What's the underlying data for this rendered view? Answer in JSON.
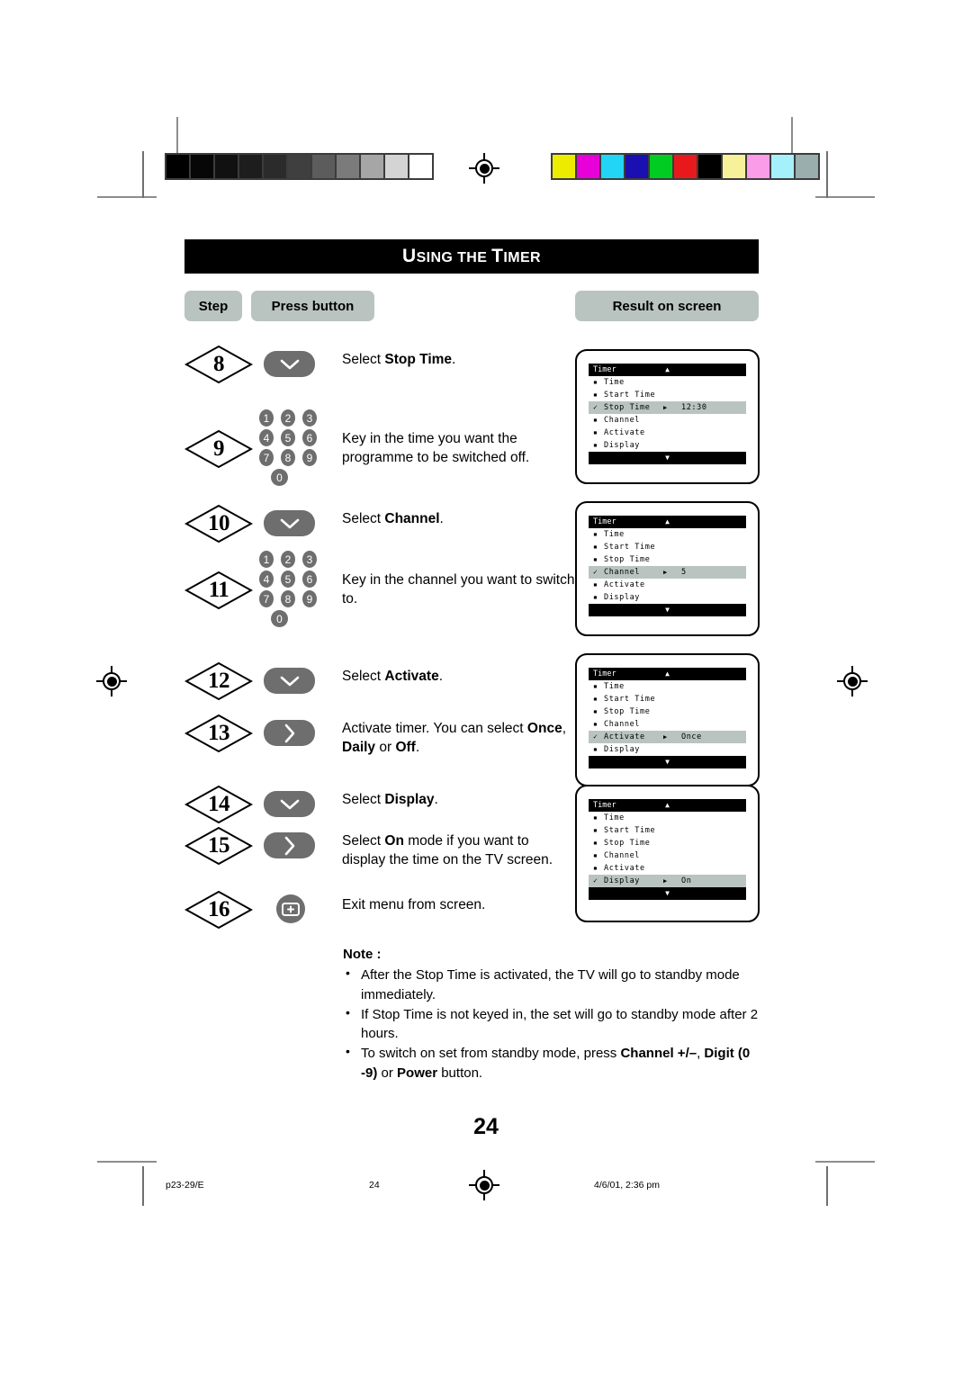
{
  "header": {
    "title_first_letter": "U",
    "title_rest_1": "SING THE ",
    "title_t": "T",
    "title_rest_2": "IMER",
    "title_plain": "Using the Timer"
  },
  "columns": {
    "step": "Step",
    "press_button": "Press button",
    "result_on_screen": "Result on screen"
  },
  "steps": [
    {
      "number": "8",
      "control": "down-arrow-button",
      "text_parts": [
        {
          "t": "Select ",
          "b": false
        },
        {
          "t": "Stop Time",
          "b": true
        },
        {
          "t": ".",
          "b": false
        }
      ]
    },
    {
      "number": "9",
      "control": "numeric-keypad",
      "text_parts": [
        {
          "t": "Key in the time you want the programme to be switched off.",
          "b": false
        }
      ]
    },
    {
      "number": "10",
      "control": "down-arrow-button",
      "text_parts": [
        {
          "t": "Select ",
          "b": false
        },
        {
          "t": "Channel",
          "b": true
        },
        {
          "t": ".",
          "b": false
        }
      ]
    },
    {
      "number": "11",
      "control": "numeric-keypad",
      "text_parts": [
        {
          "t": "Key in the channel you want to switch to.",
          "b": false
        }
      ]
    },
    {
      "number": "12",
      "control": "down-arrow-button",
      "text_parts": [
        {
          "t": "Select ",
          "b": false
        },
        {
          "t": "Activate",
          "b": true
        },
        {
          "t": ".",
          "b": false
        }
      ]
    },
    {
      "number": "13",
      "control": "right-arrow-button",
      "text_parts": [
        {
          "t": "Activate timer. You can select ",
          "b": false
        },
        {
          "t": "Once",
          "b": true
        },
        {
          "t": ", ",
          "b": false
        },
        {
          "t": "Daily",
          "b": true
        },
        {
          "t": " or ",
          "b": false
        },
        {
          "t": "Off",
          "b": true
        },
        {
          "t": ".",
          "b": false
        }
      ]
    },
    {
      "number": "14",
      "control": "down-arrow-button",
      "text_parts": [
        {
          "t": "Select ",
          "b": false
        },
        {
          "t": "Display",
          "b": true
        },
        {
          "t": ".",
          "b": false
        }
      ]
    },
    {
      "number": "15",
      "control": "right-arrow-button",
      "text_parts": [
        {
          "t": "Select ",
          "b": false
        },
        {
          "t": "On",
          "b": true
        },
        {
          "t": " mode if you want to display the time on the TV screen.",
          "b": false
        }
      ]
    },
    {
      "number": "16",
      "control": "menu-exit-button",
      "text_parts": [
        {
          "t": "Exit menu from screen.",
          "b": false
        }
      ]
    }
  ],
  "keypad_keys": [
    "1",
    "2",
    "3",
    "4",
    "5",
    "6",
    "7",
    "8",
    "9",
    "0"
  ],
  "tv_screens": [
    {
      "menu_title": "Timer",
      "up_arrow": "▲",
      "down_arrow": "▼",
      "selected": "Stop Time",
      "rows": [
        {
          "label": "Time",
          "marker": "▪",
          "pointer": "",
          "value": "",
          "selected": false
        },
        {
          "label": "Start Time",
          "marker": "▪",
          "pointer": "",
          "value": "",
          "selected": false
        },
        {
          "label": "Stop Time",
          "marker": "✓",
          "pointer": "▶",
          "value": "12:30",
          "selected": true
        },
        {
          "label": "Channel",
          "marker": "▪",
          "pointer": "",
          "value": "",
          "selected": false
        },
        {
          "label": "Activate",
          "marker": "▪",
          "pointer": "",
          "value": "",
          "selected": false
        },
        {
          "label": "Display",
          "marker": "▪",
          "pointer": "",
          "value": "",
          "selected": false
        }
      ]
    },
    {
      "menu_title": "Timer",
      "up_arrow": "▲",
      "down_arrow": "▼",
      "selected": "Channel",
      "rows": [
        {
          "label": "Time",
          "marker": "▪",
          "pointer": "",
          "value": "",
          "selected": false
        },
        {
          "label": "Start Time",
          "marker": "▪",
          "pointer": "",
          "value": "",
          "selected": false
        },
        {
          "label": "Stop Time",
          "marker": "▪",
          "pointer": "",
          "value": "",
          "selected": false
        },
        {
          "label": "Channel",
          "marker": "✓",
          "pointer": "▶",
          "value": "5",
          "selected": true
        },
        {
          "label": "Activate",
          "marker": "▪",
          "pointer": "",
          "value": "",
          "selected": false
        },
        {
          "label": "Display",
          "marker": "▪",
          "pointer": "",
          "value": "",
          "selected": false
        }
      ]
    },
    {
      "menu_title": "Timer",
      "up_arrow": "▲",
      "down_arrow": "▼",
      "selected": "Activate",
      "rows": [
        {
          "label": "Time",
          "marker": "▪",
          "pointer": "",
          "value": "",
          "selected": false
        },
        {
          "label": "Start Time",
          "marker": "▪",
          "pointer": "",
          "value": "",
          "selected": false
        },
        {
          "label": "Stop Time",
          "marker": "▪",
          "pointer": "",
          "value": "",
          "selected": false
        },
        {
          "label": "Channel",
          "marker": "▪",
          "pointer": "",
          "value": "",
          "selected": false
        },
        {
          "label": "Activate",
          "marker": "✓",
          "pointer": "▶",
          "value": "Once",
          "selected": true
        },
        {
          "label": "Display",
          "marker": "▪",
          "pointer": "",
          "value": "",
          "selected": false
        }
      ]
    },
    {
      "menu_title": "Timer",
      "up_arrow": "▲",
      "down_arrow": "▼",
      "selected": "Display",
      "rows": [
        {
          "label": "Time",
          "marker": "▪",
          "pointer": "",
          "value": "",
          "selected": false
        },
        {
          "label": "Start Time",
          "marker": "▪",
          "pointer": "",
          "value": "",
          "selected": false
        },
        {
          "label": "Stop Time",
          "marker": "▪",
          "pointer": "",
          "value": "",
          "selected": false
        },
        {
          "label": "Channel",
          "marker": "▪",
          "pointer": "",
          "value": "",
          "selected": false
        },
        {
          "label": "Activate",
          "marker": "▪",
          "pointer": "",
          "value": "",
          "selected": false
        },
        {
          "label": "Display",
          "marker": "✓",
          "pointer": "▶",
          "value": "On",
          "selected": true
        }
      ]
    }
  ],
  "note": {
    "heading": "Note :",
    "bullets": [
      [
        {
          "t": "After the Stop Time is activated, the TV will go to standby mode immediately.",
          "b": false
        }
      ],
      [
        {
          "t": "If Stop Time is not keyed in,  the set will go to standby mode after 2 hours.",
          "b": false
        }
      ],
      [
        {
          "t": "To switch on set from standby mode, press ",
          "b": false
        },
        {
          "t": "Channel +/–",
          "b": true
        },
        {
          "t": ", ",
          "b": false
        },
        {
          "t": "Digit (0 -9)",
          "b": true
        },
        {
          "t": " or ",
          "b": false
        },
        {
          "t": "Power",
          "b": true
        },
        {
          "t": " button.",
          "b": false
        }
      ]
    ]
  },
  "page_number": "24",
  "footer": {
    "file_ref": "p23-29/E",
    "page": "24",
    "timestamp": "4/6/01, 2:36 pm"
  },
  "calibration": {
    "grayscale": [
      "#000000",
      "#070707",
      "#111111",
      "#1d1d1d",
      "#2b2b2b",
      "#3f3f3f",
      "#5c5c5c",
      "#7b7b7b",
      "#a6a6a6",
      "#d4d4d4",
      "#ffffff"
    ],
    "colors": [
      "#ecec00",
      "#e800d8",
      "#22d5f5",
      "#1a0fb0",
      "#00cc22",
      "#e8191c",
      "#000000",
      "#f7f29a",
      "#fb9ce8",
      "#a5f0fb",
      "#9aaeae"
    ]
  },
  "colors": {
    "accent_pill": "#b9c4c0",
    "button_gray": "#6e6e6e",
    "banner_black": "#000000"
  }
}
